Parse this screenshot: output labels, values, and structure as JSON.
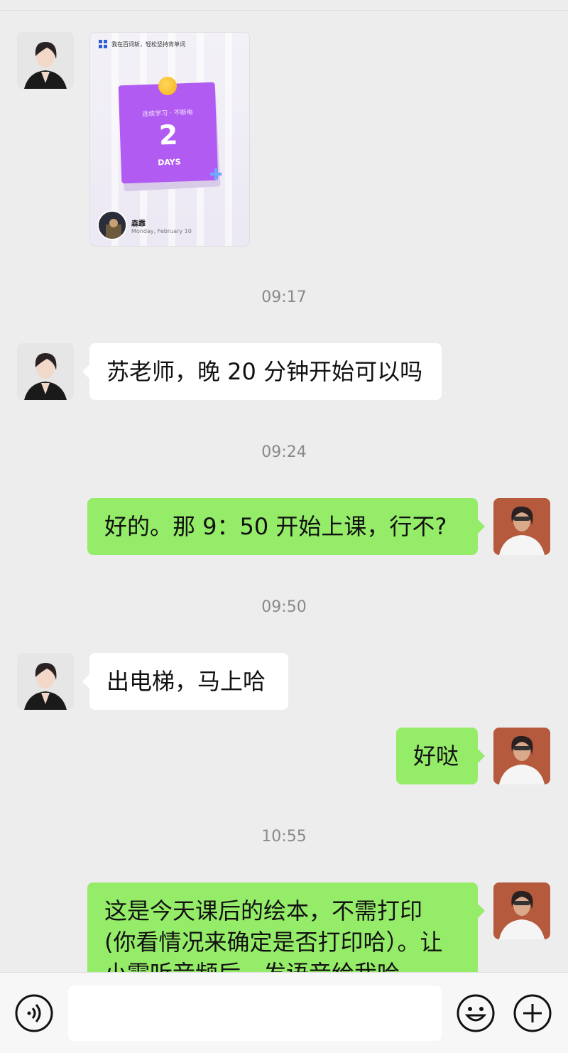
{
  "card": {
    "header": "我在百词斩，轻松坚持背单词",
    "streak_label": "连续学习 · 不断电",
    "days_number": "2",
    "days_label": "DAYS",
    "user_name": "森霏",
    "date": "Monday, February 10"
  },
  "times": [
    "09:17",
    "09:24",
    "09:50",
    "10:55"
  ],
  "messages": [
    {
      "side": "in",
      "text": "苏老师，晚 20 分钟开始可以吗"
    },
    {
      "side": "out",
      "text": "好的。那 9：50 开始上课，行不?"
    },
    {
      "side": "in",
      "text": "出电梯，马上哈"
    },
    {
      "side": "out",
      "text": "好哒"
    },
    {
      "side": "out",
      "line1": "这是今天课后的绘本，不需打印",
      "line2": "(你看情况来确定是否打印哈）。让",
      "line3": "小霏听音频后，发语音给我哈"
    }
  ],
  "input": {
    "value": ""
  },
  "icons": {
    "voice": "voice-icon",
    "emoji": "emoji-icon",
    "more": "plus-icon"
  },
  "colors": {
    "background": "#ededed",
    "out_bubble": "#95ec69",
    "in_bubble": "#ffffff",
    "card_note": "#b15bf2"
  }
}
